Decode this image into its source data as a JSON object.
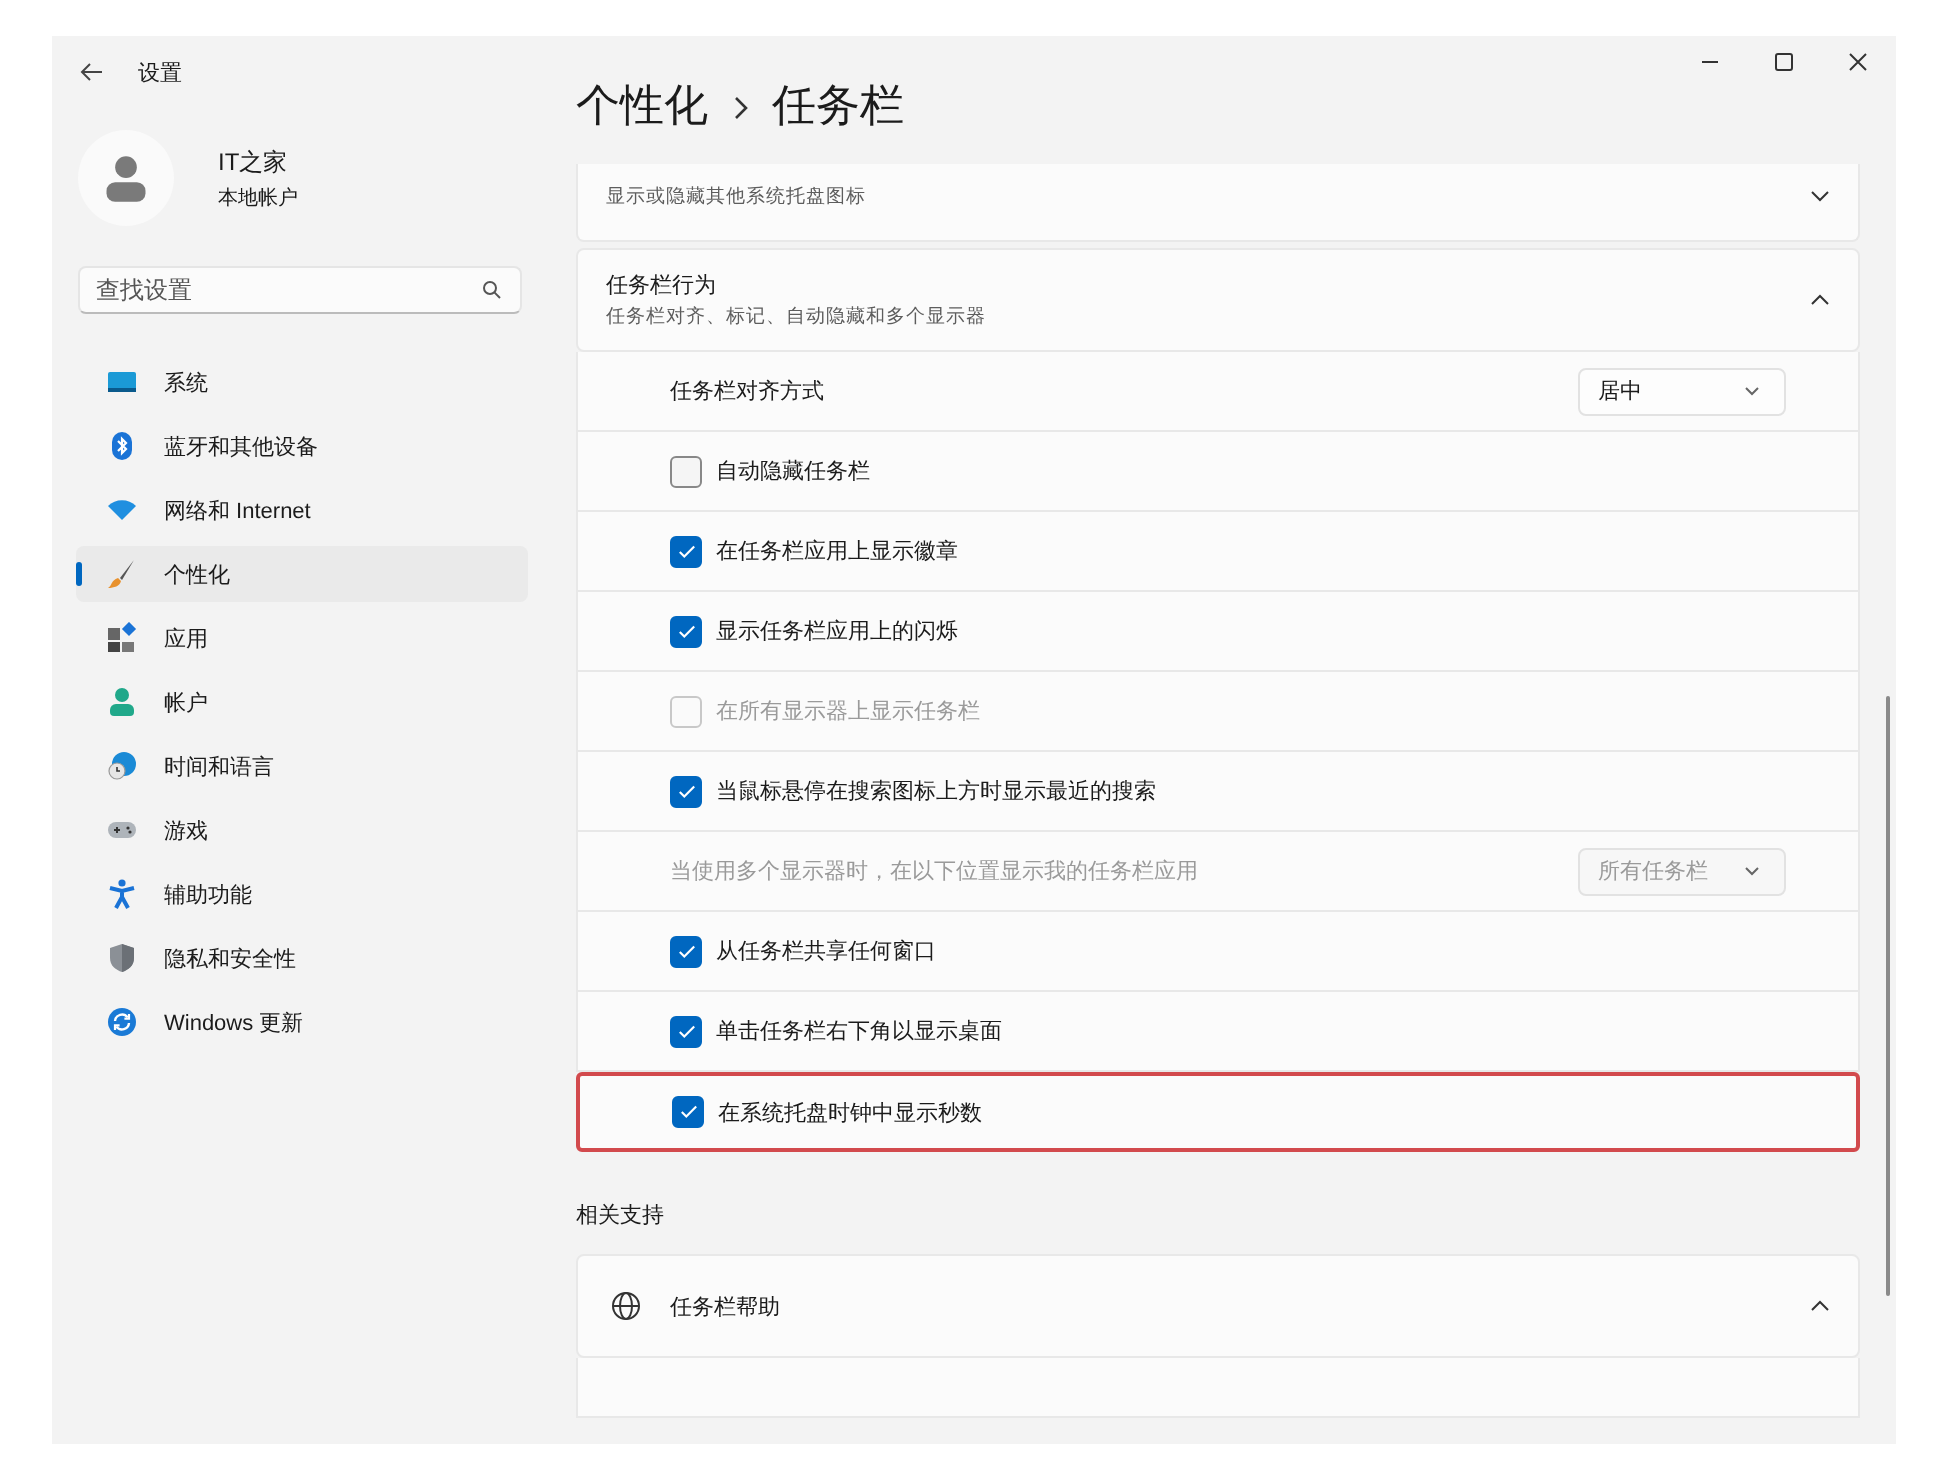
{
  "window": {
    "title": "设置"
  },
  "account": {
    "name": "IT之家",
    "type": "本地帐户"
  },
  "search": {
    "placeholder": "查找设置"
  },
  "nav": [
    {
      "kind": "system",
      "label": "系统",
      "selected": false
    },
    {
      "kind": "bluetooth",
      "label": "蓝牙和其他设备",
      "selected": false
    },
    {
      "kind": "network",
      "label": "网络和 Internet",
      "selected": false
    },
    {
      "kind": "brush",
      "label": "个性化",
      "selected": true
    },
    {
      "kind": "apps",
      "label": "应用",
      "selected": false
    },
    {
      "kind": "account",
      "label": "帐户",
      "selected": false
    },
    {
      "kind": "time",
      "label": "时间和语言",
      "selected": false
    },
    {
      "kind": "gaming",
      "label": "游戏",
      "selected": false
    },
    {
      "kind": "accessibility",
      "label": "辅助功能",
      "selected": false
    },
    {
      "kind": "privacy",
      "label": "隐私和安全性",
      "selected": false
    },
    {
      "kind": "update",
      "label": "Windows 更新",
      "selected": false
    }
  ],
  "breadcrumb": {
    "parent": "个性化",
    "current": "任务栏"
  },
  "sections": [
    {
      "subtitle": "显示或隐藏其他系统托盘图标",
      "expanded": false
    },
    {
      "title": "任务栏行为",
      "subtitle": "任务栏对齐、标记、自动隐藏和多个显示器",
      "expanded": true,
      "rows": [
        {
          "kind": "dropdown",
          "label": "任务栏对齐方式",
          "value": "居中",
          "disabled": false
        },
        {
          "kind": "checkbox",
          "label": "自动隐藏任务栏",
          "checked": false,
          "disabled": false,
          "highlighted": false
        },
        {
          "kind": "checkbox",
          "label": "在任务栏应用上显示徽章",
          "checked": true,
          "disabled": false,
          "highlighted": false
        },
        {
          "kind": "checkbox",
          "label": "显示任务栏应用上的闪烁",
          "checked": true,
          "disabled": false,
          "highlighted": false
        },
        {
          "kind": "checkbox",
          "label": "在所有显示器上显示任务栏",
          "checked": false,
          "disabled": true,
          "highlighted": false
        },
        {
          "kind": "checkbox",
          "label": "当鼠标悬停在搜索图标上方时显示最近的搜索",
          "checked": true,
          "disabled": false,
          "highlighted": false
        },
        {
          "kind": "dropdown",
          "label": "当使用多个显示器时，在以下位置显示我的任务栏应用",
          "value": "所有任务栏",
          "disabled": true
        },
        {
          "kind": "checkbox",
          "label": "从任务栏共享任何窗口",
          "checked": true,
          "disabled": false,
          "highlighted": false
        },
        {
          "kind": "checkbox",
          "label": "单击任务栏右下角以显示桌面",
          "checked": true,
          "disabled": false,
          "highlighted": false
        },
        {
          "kind": "checkbox",
          "label": "在系统托盘时钟中显示秒数",
          "checked": true,
          "disabled": false,
          "highlighted": true
        }
      ]
    }
  ],
  "related": {
    "heading": "相关支持",
    "items": [
      {
        "title": "任务栏帮助",
        "expanded": true
      }
    ]
  }
}
